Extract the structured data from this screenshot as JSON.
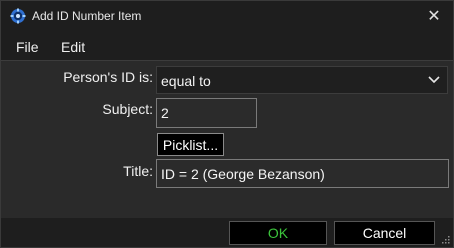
{
  "window": {
    "title": "Add ID Number Item",
    "app_icon": "gear-globe-icon",
    "close_icon": "close-icon",
    "close_glyph": "✕"
  },
  "menu": {
    "items": [
      {
        "label": "File"
      },
      {
        "label": "Edit"
      }
    ]
  },
  "form": {
    "person_id_label": "Person's ID is:",
    "person_id_value": "equal to",
    "subject_label": "Subject:",
    "subject_value": "2",
    "picklist_label": "Picklist...",
    "title_label": "Title:",
    "title_value": "ID = 2 (George Bezanson)"
  },
  "footer": {
    "ok_label": "OK",
    "cancel_label": "Cancel"
  },
  "colors": {
    "ok_text": "#3cc43c",
    "accent": "#1e5aa8"
  }
}
